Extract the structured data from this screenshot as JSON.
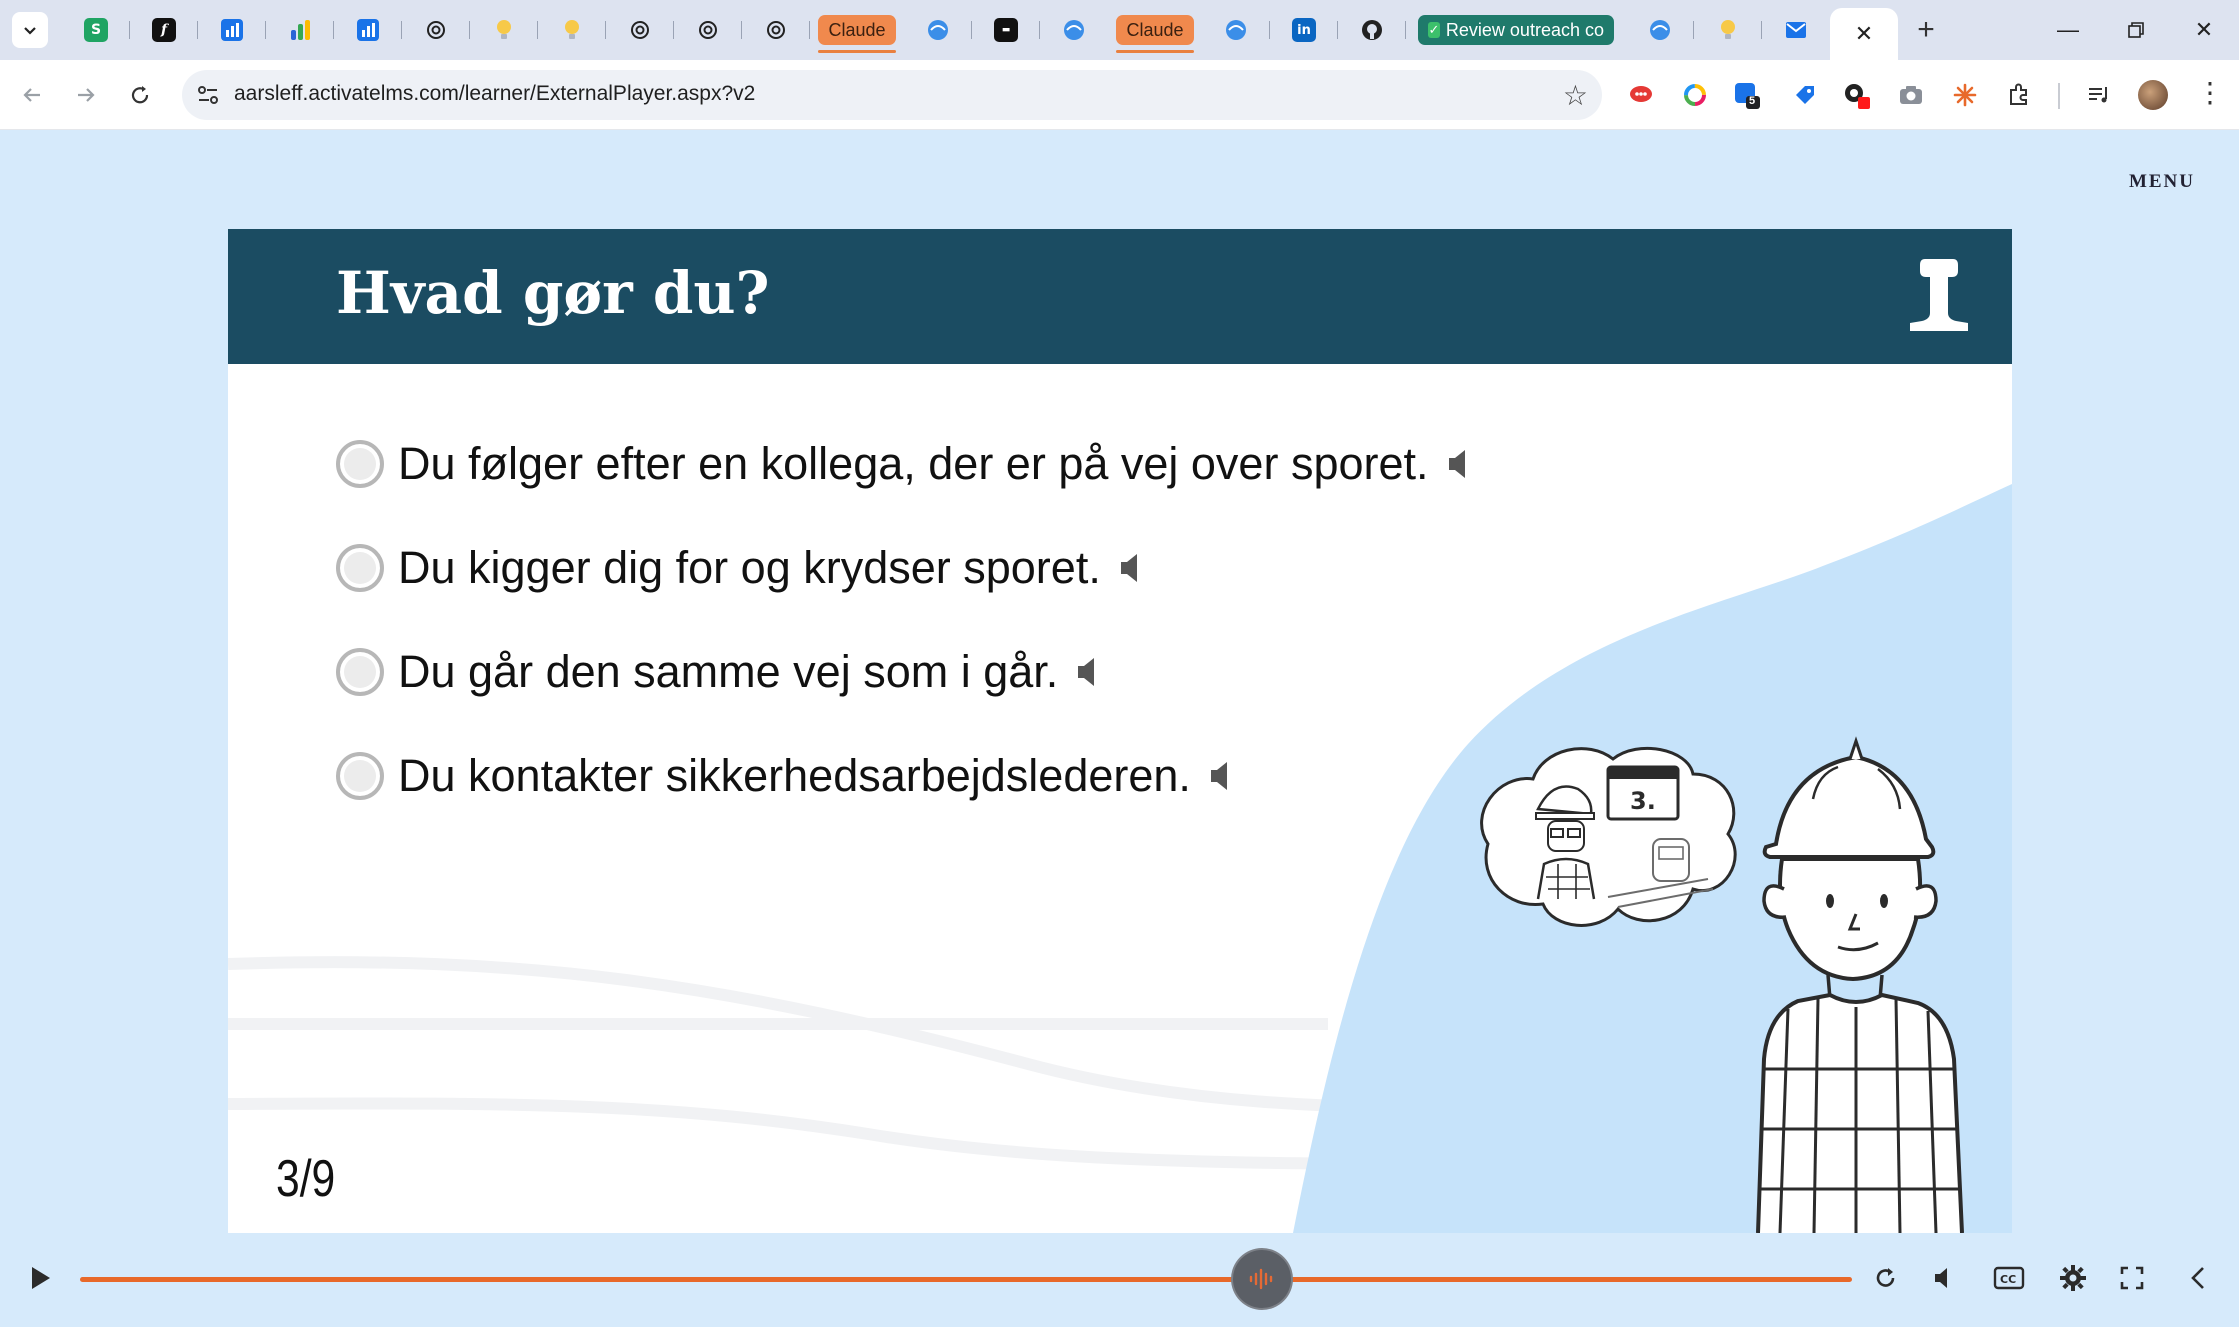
{
  "browser": {
    "tabs": [
      {
        "type": "pinned",
        "icon": "spreadsheet-s-icon",
        "letter": "S"
      },
      {
        "type": "pinned",
        "icon": "formula-f-icon",
        "letter": "f"
      },
      {
        "type": "pinned",
        "icon": "bar-chart-icon"
      },
      {
        "type": "pinned",
        "icon": "analytics-icon"
      },
      {
        "type": "pinned",
        "icon": "bar-chart-icon"
      },
      {
        "type": "pinned",
        "icon": "openai-icon"
      },
      {
        "type": "pinned",
        "icon": "lightbulb-icon"
      },
      {
        "type": "pinned",
        "icon": "lightbulb-icon"
      },
      {
        "type": "pinned",
        "icon": "openai-icon"
      },
      {
        "type": "pinned",
        "icon": "openai-icon"
      },
      {
        "type": "pinned",
        "icon": "openai-icon"
      }
    ],
    "claude_tab_1": "Claude",
    "claude_tab_2": "Claude",
    "review_tab": "Review outreach co",
    "url": "aarsleff.activatelms.com/learner/ExternalPlayer.aspx?v2",
    "ext_badge": "5",
    "accent_colors": {
      "claude": "#f0894d",
      "review": "#1f7a6b",
      "progress": "#e8692a"
    }
  },
  "player": {
    "menu_label": "MENU",
    "slide_title": "Hvad gør du?",
    "options": [
      "Du følger efter en kollega, der er på vej over sporet.",
      "Du kigger dig for og krydser sporet.",
      "Du går den samme vej som i går.",
      "Du kontakter sikkerhedsarbejdslederen."
    ],
    "slide_counter": "3/9",
    "thought_bubble_label": "3.",
    "header_color": "#1b4c62",
    "progress_fraction": 0.667
  }
}
